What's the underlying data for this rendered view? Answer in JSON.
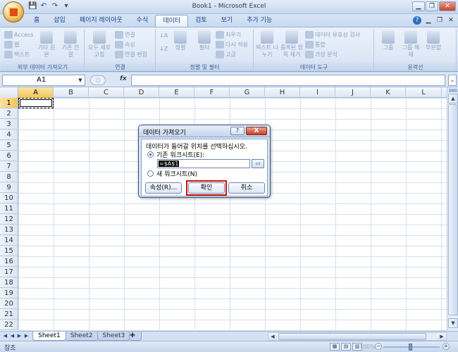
{
  "window": {
    "title": "Book1 - Microsoft Excel"
  },
  "quick_access": {
    "save": "💾",
    "undo": "↶",
    "redo": "↷",
    "more": "▾"
  },
  "tabs": [
    "홈",
    "삽입",
    "페이지 레이아웃",
    "수식",
    "데이터",
    "검토",
    "보기",
    "추가 기능"
  ],
  "active_tab": "데이터",
  "ribbon": {
    "groups": [
      {
        "label": "외부 데이터 가져오기",
        "items": [
          "Access",
          "웹",
          "텍스트",
          "기타 원본",
          "기존 연결"
        ]
      },
      {
        "label": "연결",
        "items": [
          "모두 새로 고침",
          "연결",
          "속성",
          "연결 편집"
        ]
      },
      {
        "label": "정렬 및 필터",
        "items": [
          "정렬",
          "필터",
          "지우기",
          "다시 적용",
          "고급"
        ]
      },
      {
        "label": "데이터 도구",
        "items": [
          "텍스트 나누기",
          "중복된 항목 제거",
          "데이터 유효성 검사",
          "통합",
          "가상 분석"
        ]
      },
      {
        "label": "윤곽선",
        "items": [
          "그룹",
          "그룹 해제",
          "부분합"
        ]
      }
    ]
  },
  "formula_bar": {
    "name_box": "A1",
    "fx": "fx",
    "content": ""
  },
  "grid": {
    "columns": [
      "A",
      "B",
      "C",
      "D",
      "E",
      "F",
      "G",
      "H",
      "I",
      "J",
      "K",
      "L"
    ],
    "rows": [
      "1",
      "2",
      "3",
      "4",
      "5",
      "6",
      "7",
      "8",
      "9",
      "10",
      "11",
      "12",
      "13",
      "14",
      "15",
      "16",
      "17",
      "18",
      "19",
      "20",
      "21",
      "22"
    ],
    "active_cell": "A1"
  },
  "sheets": [
    "Sheet1",
    "Sheet2",
    "Sheet3"
  ],
  "active_sheet": "Sheet1",
  "status": {
    "mode": "참조",
    "zoom": "100%"
  },
  "dialog": {
    "title": "데이터 가져오기",
    "help": "?",
    "close": "X",
    "prompt": "데이터가 들어갈 위치를 선택하십시오.",
    "option_existing": "기존 워크시트(E):",
    "range_value": "=$A$1",
    "option_new": "새 워크시트(N)",
    "btn_properties": "속성(R)...",
    "btn_ok": "확인",
    "btn_cancel": "취소",
    "selected_option": "existing"
  },
  "colors": {
    "accent": "#15428b",
    "highlight_box": "#cc1111",
    "selected_header": "#f3c457"
  }
}
